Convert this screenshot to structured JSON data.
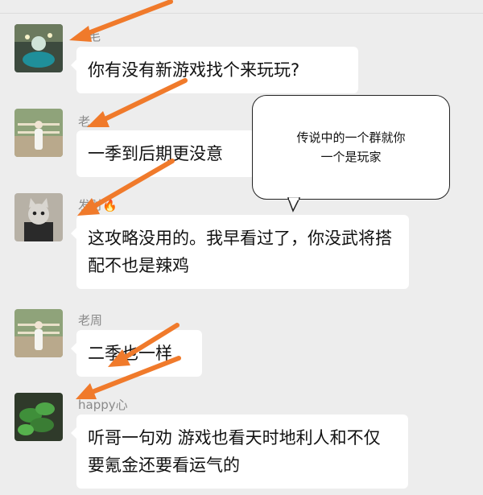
{
  "messages": [
    {
      "name": "毛",
      "nick_prefix": "",
      "text": "你有没有新游戏找个来玩玩?",
      "avatar": "neon-figure-avatar"
    },
    {
      "name": "老",
      "nick_prefix": "",
      "text": "一季到后期更没意",
      "avatar": "person-standing-avatar"
    },
    {
      "name": "发财",
      "nick_prefix": "",
      "text": "这攻略没用的。我早看过了，你没武将搭配不也是辣鸡",
      "avatar": "cat-mask-avatar",
      "flame": "🔥"
    },
    {
      "name": "老周",
      "nick_prefix": "",
      "text": "二季也一样",
      "avatar": "person-standing-avatar"
    },
    {
      "name": "happy心",
      "nick_prefix": "",
      "text": "听哥一句劝 游戏也看天时地利人和不仅要氪金还要看运气的",
      "avatar": "plant-avatar"
    }
  ],
  "callout": {
    "line1": "传说中的一个群就你",
    "line2": "一个是玩家"
  },
  "colors": {
    "arrow": "#f07a2b",
    "bubble": "#ffffff",
    "background": "#ededed"
  }
}
